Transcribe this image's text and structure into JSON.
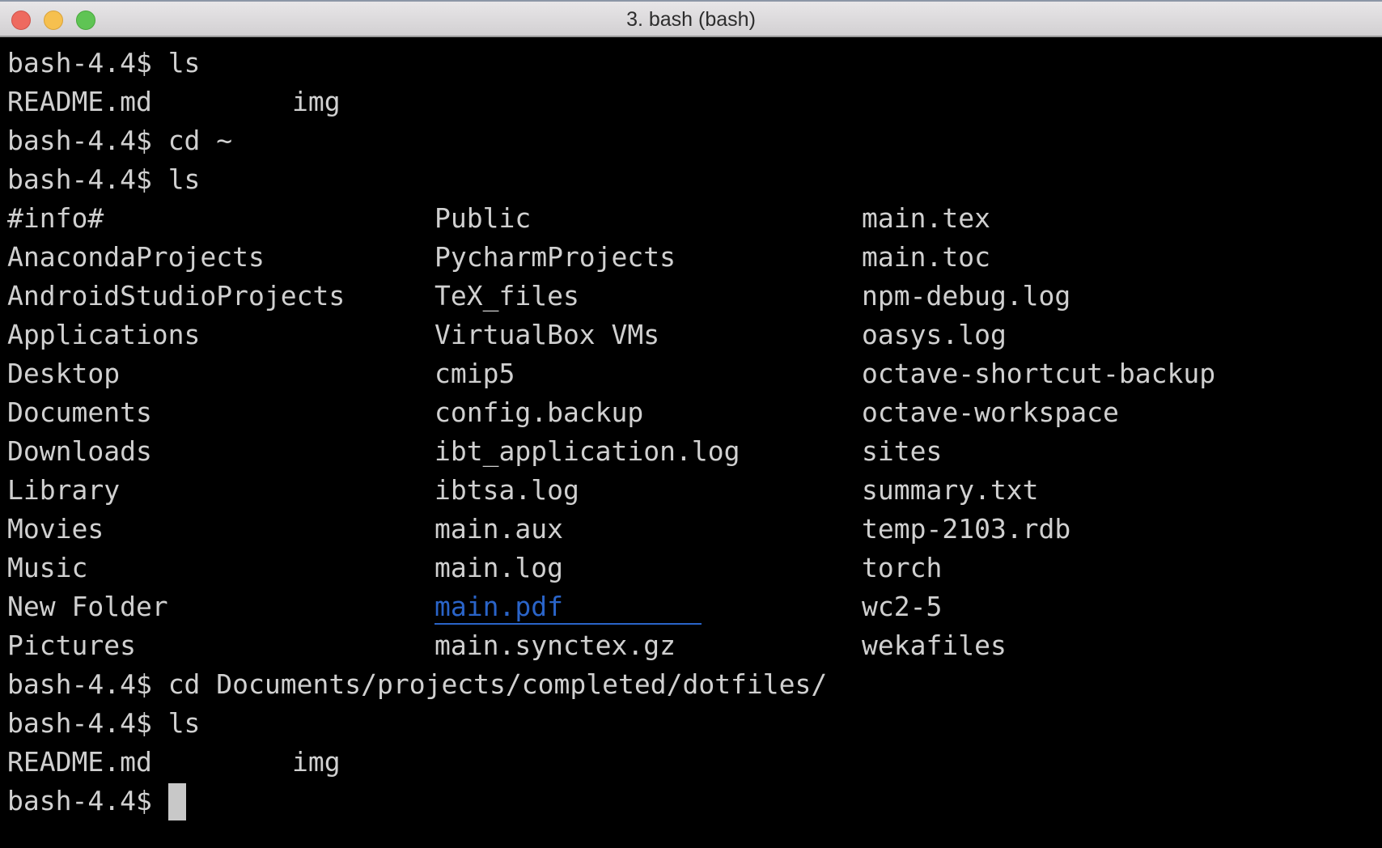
{
  "window": {
    "title": "3. bash (bash)",
    "buttons": {
      "close": "close",
      "minimize": "minimize",
      "zoom": "zoom"
    }
  },
  "colors": {
    "background": "#000000",
    "text": "#d0d0d0",
    "link": "#2a64c8",
    "cursor": "#c8c8c8"
  },
  "prompt": "bash-4.4$",
  "session": [
    {
      "type": "command",
      "command": "ls"
    },
    {
      "type": "output2",
      "cols": [
        "README.md",
        "img"
      ]
    },
    {
      "type": "command",
      "command": "cd ~"
    },
    {
      "type": "command",
      "command": "ls"
    },
    {
      "type": "listing",
      "rows": [
        [
          "#info#",
          "Public",
          "main.tex"
        ],
        [
          "AnacondaProjects",
          "PycharmProjects",
          "main.toc"
        ],
        [
          "AndroidStudioProjects",
          "TeX_files",
          "npm-debug.log"
        ],
        [
          "Applications",
          "VirtualBox VMs",
          "oasys.log"
        ],
        [
          "Desktop",
          "cmip5",
          "octave-shortcut-backup"
        ],
        [
          "Documents",
          "config.backup",
          "octave-workspace"
        ],
        [
          "Downloads",
          "ibt_application.log",
          "sites"
        ],
        [
          "Library",
          "ibtsa.log",
          "summary.txt"
        ],
        [
          "Movies",
          "main.aux",
          "temp-2103.rdb"
        ],
        [
          "Music",
          "main.log",
          "torch"
        ],
        [
          "New Folder",
          "main.pdf",
          "wc2-5"
        ],
        [
          "Pictures",
          "main.synctex.gz",
          "wekafiles"
        ]
      ],
      "highlighted": "main.pdf"
    },
    {
      "type": "command",
      "command": "cd Documents/projects/completed/dotfiles/"
    },
    {
      "type": "command",
      "command": "ls"
    },
    {
      "type": "output2",
      "cols": [
        "README.md",
        "img"
      ]
    },
    {
      "type": "prompt_cursor"
    }
  ]
}
